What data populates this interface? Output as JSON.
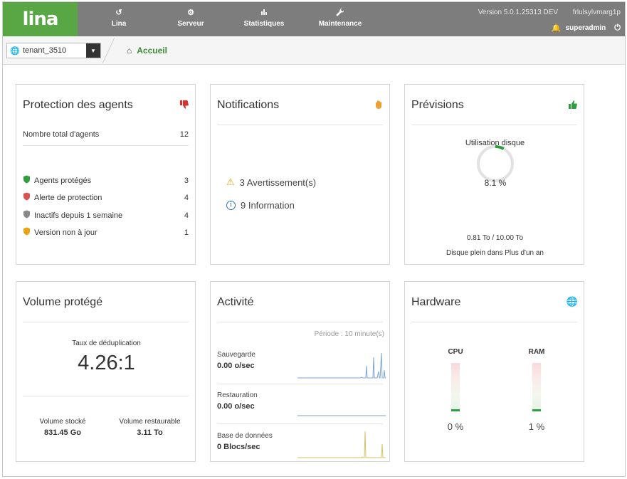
{
  "header": {
    "logo": "lina",
    "nav": [
      {
        "label": "Lina",
        "icon": "history-icon"
      },
      {
        "label": "Serveur",
        "icon": "gear-icon"
      },
      {
        "label": "Statistiques",
        "icon": "bar-chart-icon"
      },
      {
        "label": "Maintenance",
        "icon": "wrench-icon"
      }
    ],
    "version": "Version 5.0.1.25313 DEV",
    "user_id": "frlulsylvmarg1p",
    "username": "superadmin"
  },
  "subbar": {
    "tenant": "tenant_3510",
    "breadcrumb": "Accueil"
  },
  "agents": {
    "title": "Protection des agents",
    "total_label": "Nombre total d'agents",
    "total_value": "12",
    "rows": [
      {
        "label": "Agents protégés",
        "value": "3",
        "color": "#2e9e3e"
      },
      {
        "label": "Alerte de protection",
        "value": "4",
        "color": "#d9534f"
      },
      {
        "label": "Inactifs depuis 1 semaine",
        "value": "4",
        "color": "#888888"
      },
      {
        "label": "Version non à jour",
        "value": "1",
        "color": "#e8a317"
      }
    ]
  },
  "notifications": {
    "title": "Notifications",
    "warnings": "3 Avertissement(s)",
    "info": "9 Information"
  },
  "forecast": {
    "title": "Prévisions",
    "disk_label": "Utilisation disque",
    "disk_percent": "8.1 %",
    "disk_fraction": 0.081,
    "disk_usage": "0.81 To / 10.00 To",
    "disk_full": "Disque plein dans Plus d'un an"
  },
  "volume": {
    "title": "Volume protégé",
    "dedup_label": "Taux de déduplication",
    "dedup_value": "4.26:1",
    "stored_label": "Volume stocké",
    "stored_value": "831.45 Go",
    "restorable_label": "Volume restaurable",
    "restorable_value": "3.11 To"
  },
  "activity": {
    "title": "Activité",
    "period": "Période : 10 minute(s)",
    "rows": [
      {
        "label": "Sauvegarde",
        "value": "0.00 o/sec",
        "color": "#7ea6d8"
      },
      {
        "label": "Restauration",
        "value": "0.00 o/sec",
        "color": "#8aa0b0"
      },
      {
        "label": "Base de données",
        "value": "0 Blocs/sec",
        "color": "#d4c26a"
      }
    ]
  },
  "hardware": {
    "title": "Hardware",
    "cpu_label": "CPU",
    "cpu_value": "0 %",
    "cpu_fraction": 0.0,
    "ram_label": "RAM",
    "ram_value": "1 %",
    "ram_fraction": 0.01
  },
  "colors": {
    "brand_green": "#58a744",
    "topbar_gray": "#7d7d7d",
    "thumbs_down": "#d9302c",
    "hand": "#f0a030",
    "thumbs_up": "#2e9e3e"
  }
}
